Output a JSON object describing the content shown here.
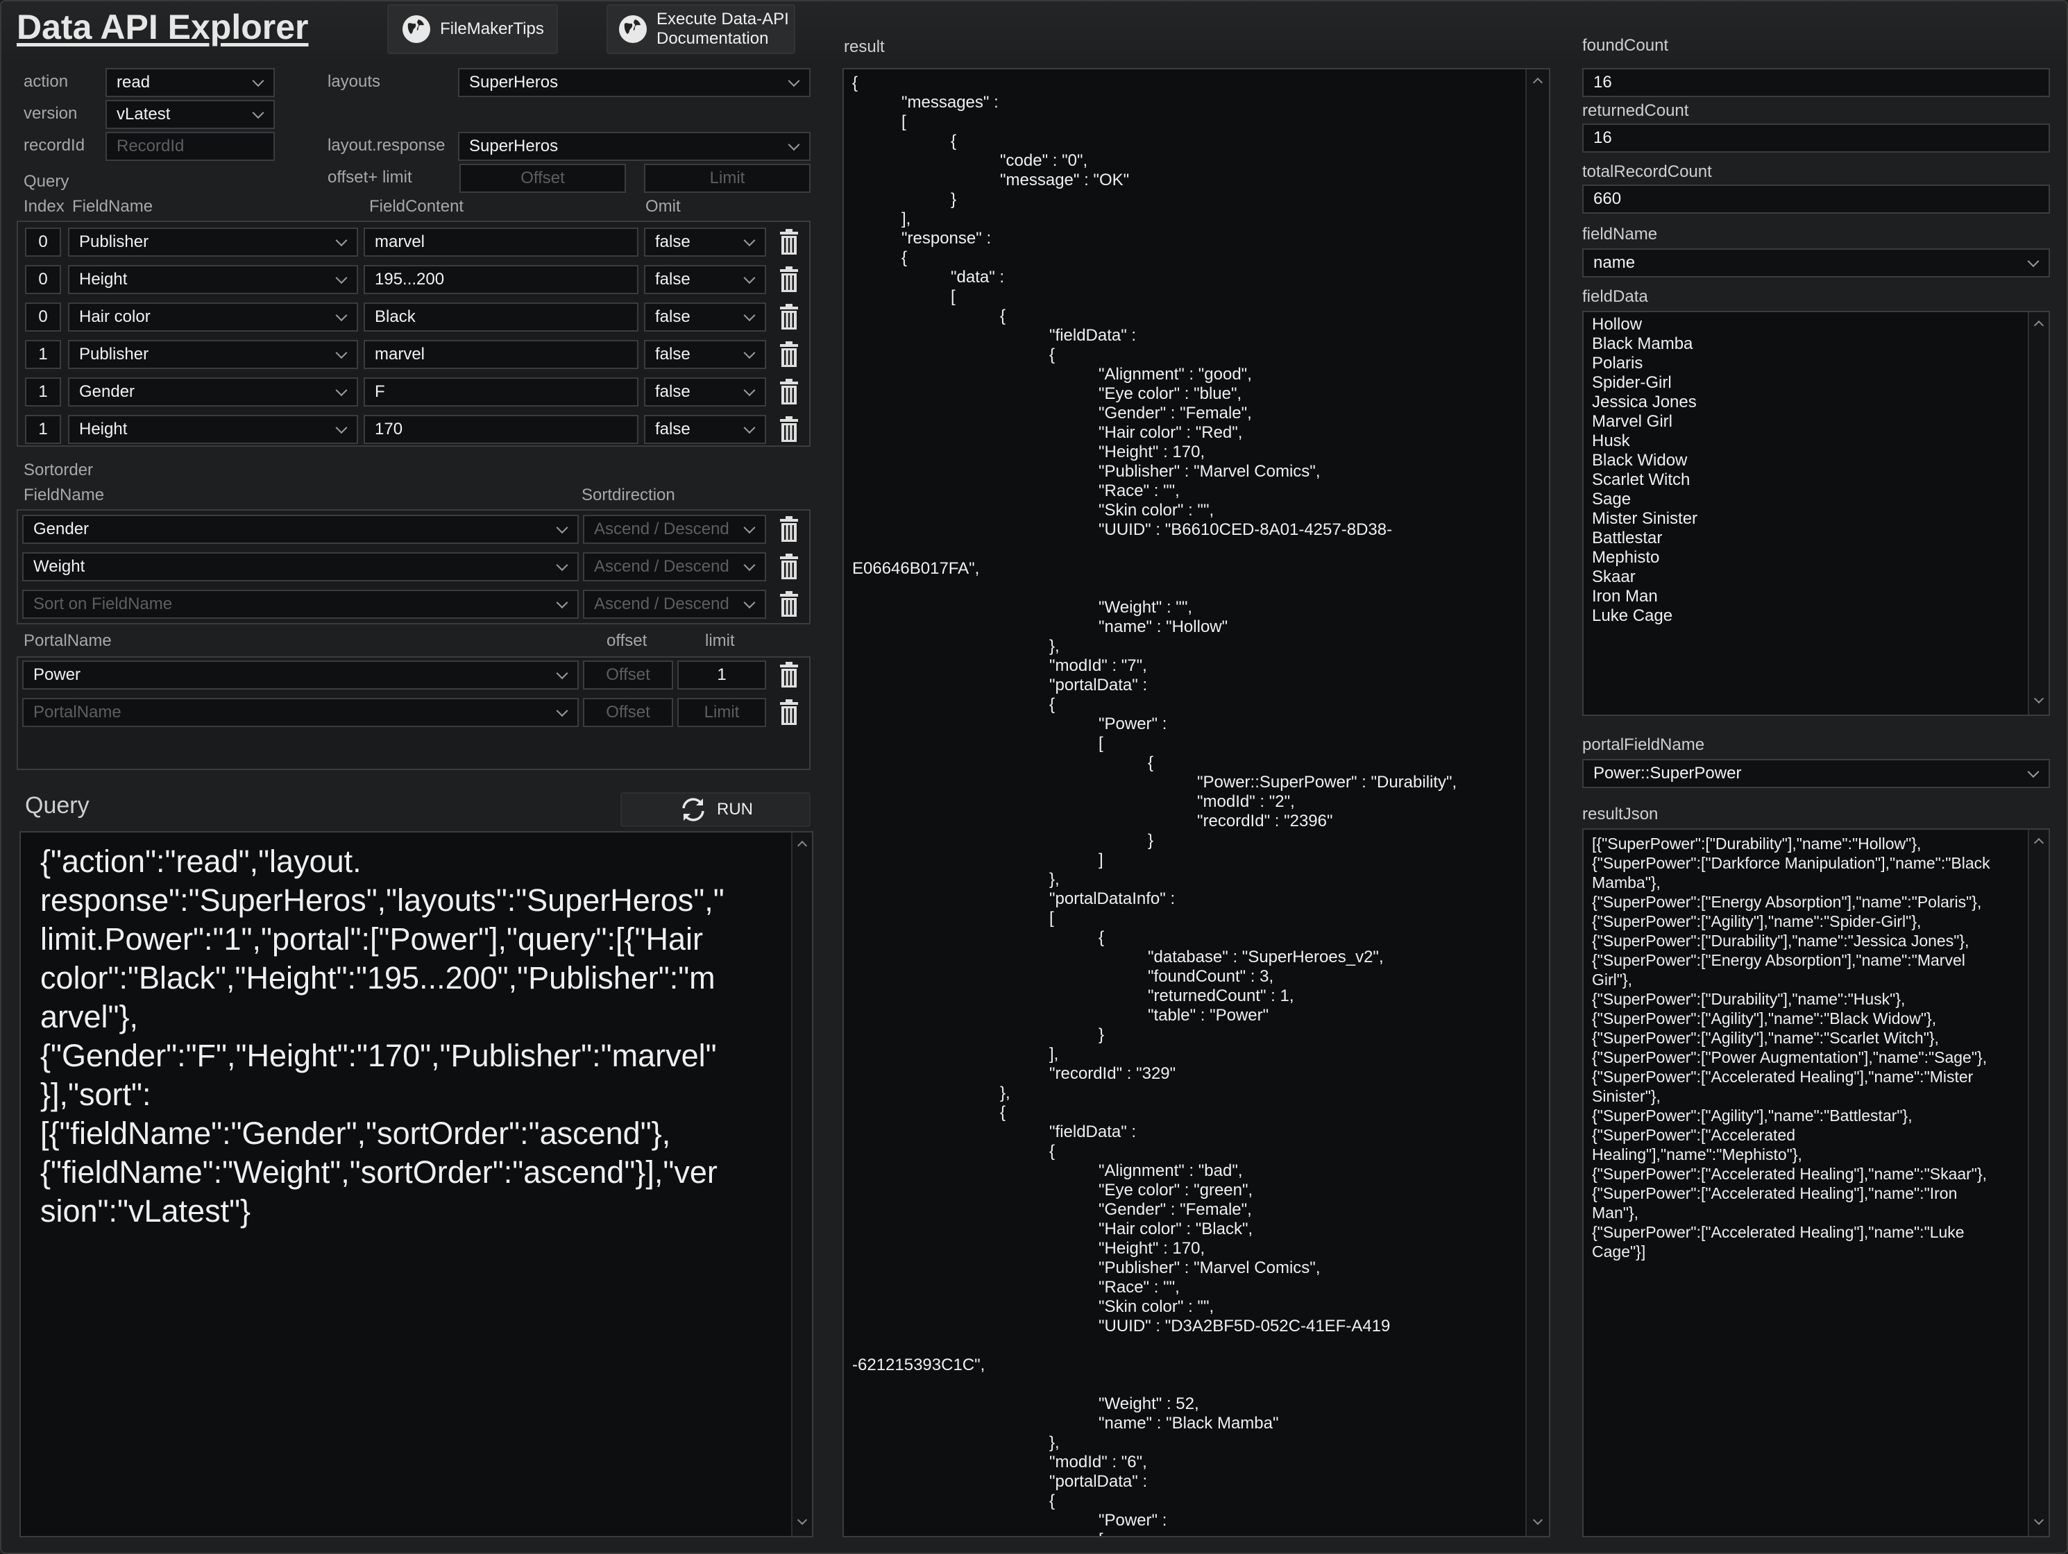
{
  "header": {
    "title": "Data API Explorer",
    "btn_filemakertips": "FileMakerTips",
    "btn_docs_line1": "Execute Data-API",
    "btn_docs_line2": "Documentation"
  },
  "form": {
    "action_label": "action",
    "action_value": "read",
    "version_label": "version",
    "version_value": "vLatest",
    "recordid_label": "recordId",
    "recordid_placeholder": "RecordId",
    "layouts_label": "layouts",
    "layouts_value": "SuperHeros",
    "layout_response_label": "layout.response",
    "layout_response_value": "SuperHeros",
    "offset_limit_label": "offset+ limit",
    "offset_placeholder": "Offset",
    "limit_placeholder": "Limit"
  },
  "query_section": {
    "title": "Query",
    "col_index": "Index",
    "col_fieldname": "FieldName",
    "col_fieldcontent": "FieldContent",
    "col_omit": "Omit",
    "rows": [
      {
        "index": "0",
        "field": "Publisher",
        "content": "marvel",
        "omit": "false"
      },
      {
        "index": "0",
        "field": "Height",
        "content": "195...200",
        "omit": "false"
      },
      {
        "index": "0",
        "field": "Hair color",
        "content": "Black",
        "omit": "false"
      },
      {
        "index": "1",
        "field": "Publisher",
        "content": "marvel",
        "omit": "false"
      },
      {
        "index": "1",
        "field": "Gender",
        "content": "F",
        "omit": "false"
      },
      {
        "index": "1",
        "field": "Height",
        "content": "170",
        "omit": "false"
      }
    ]
  },
  "sort_section": {
    "title": "Sortorder",
    "col_fieldname": "FieldName",
    "col_direction": "Sortdirection",
    "rows": [
      {
        "field": "Gender",
        "direction": "Ascend / Descend"
      },
      {
        "field": "Weight",
        "direction": "Ascend / Descend"
      },
      {
        "field": "Sort on FieldName",
        "direction": "Ascend / Descend"
      }
    ]
  },
  "portal_section": {
    "col_portalname": "PortalName",
    "col_offset": "offset",
    "col_limit": "limit",
    "rows": [
      {
        "name": "Power",
        "offset": "Offset",
        "limit": "1"
      },
      {
        "name": "PortalName",
        "offset": "Offset",
        "limit": "Limit"
      }
    ]
  },
  "query_output": {
    "title": "Query",
    "run_label": "RUN",
    "text": "{\"action\":\"read\",\"layout.\nresponse\":\"SuperHeros\",\"layouts\":\"SuperHeros\",\"\nlimit.Power\":\"1\",\"portal\":[\"Power\"],\"query\":[{\"Hair\ncolor\":\"Black\",\"Height\":\"195...200\",\"Publisher\":\"m\narvel\"},\n{\"Gender\":\"F\",\"Height\":\"170\",\"Publisher\":\"marvel\"\n}],\"sort\":\n[{\"fieldName\":\"Gender\",\"sortOrder\":\"ascend\"},\n{\"fieldName\":\"Weight\",\"sortOrder\":\"ascend\"}],\"ver\nsion\":\"vLatest\"}"
  },
  "result": {
    "label": "result",
    "text": "{\n\t\"messages\" :\n\t[\n\t\t{\n\t\t\t\"code\" : \"0\",\n\t\t\t\"message\" : \"OK\"\n\t\t}\n\t],\n\t\"response\" :\n\t{\n\t\t\"data\" :\n\t\t[\n\t\t\t{\n\t\t\t\t\"fieldData\" :\n\t\t\t\t{\n\t\t\t\t\t\"Alignment\" : \"good\",\n\t\t\t\t\t\"Eye color\" : \"blue\",\n\t\t\t\t\t\"Gender\" : \"Female\",\n\t\t\t\t\t\"Hair color\" : \"Red\",\n\t\t\t\t\t\"Height\" : 170,\n\t\t\t\t\t\"Publisher\" : \"Marvel Comics\",\n\t\t\t\t\t\"Race\" : \"\",\n\t\t\t\t\t\"Skin color\" : \"\",\n\t\t\t\t\t\"UUID\" : \"B6610CED-8A01-4257-8D38-\n\nE06646B017FA\",\n\n\t\t\t\t\t\"Weight\" : \"\",\n\t\t\t\t\t\"name\" : \"Hollow\"\n\t\t\t\t},\n\t\t\t\t\"modId\" : \"7\",\n\t\t\t\t\"portalData\" :\n\t\t\t\t{\n\t\t\t\t\t\"Power\" :\n\t\t\t\t\t[\n\t\t\t\t\t\t{\n\t\t\t\t\t\t\t\"Power::SuperPower\" : \"Durability\",\n\t\t\t\t\t\t\t\"modId\" : \"2\",\n\t\t\t\t\t\t\t\"recordId\" : \"2396\"\n\t\t\t\t\t\t}\n\t\t\t\t\t]\n\t\t\t\t},\n\t\t\t\t\"portalDataInfo\" :\n\t\t\t\t[\n\t\t\t\t\t{\n\t\t\t\t\t\t\"database\" : \"SuperHeroes_v2\",\n\t\t\t\t\t\t\"foundCount\" : 3,\n\t\t\t\t\t\t\"returnedCount\" : 1,\n\t\t\t\t\t\t\"table\" : \"Power\"\n\t\t\t\t\t}\n\t\t\t\t],\n\t\t\t\t\"recordId\" : \"329\"\n\t\t\t},\n\t\t\t{\n\t\t\t\t\"fieldData\" :\n\t\t\t\t{\n\t\t\t\t\t\"Alignment\" : \"bad\",\n\t\t\t\t\t\"Eye color\" : \"green\",\n\t\t\t\t\t\"Gender\" : \"Female\",\n\t\t\t\t\t\"Hair color\" : \"Black\",\n\t\t\t\t\t\"Height\" : 170,\n\t\t\t\t\t\"Publisher\" : \"Marvel Comics\",\n\t\t\t\t\t\"Race\" : \"\",\n\t\t\t\t\t\"Skin color\" : \"\",\n\t\t\t\t\t\"UUID\" : \"D3A2BF5D-052C-41EF-A419\n\n-621215393C1C\",\n\n\t\t\t\t\t\"Weight\" : 52,\n\t\t\t\t\t\"name\" : \"Black Mamba\"\n\t\t\t\t},\n\t\t\t\t\"modId\" : \"6\",\n\t\t\t\t\"portalData\" :\n\t\t\t\t{\n\t\t\t\t\t\"Power\" :\n\t\t\t\t\t[\n\t\t\t\t\t\t{\n\t\t\t\t\t\t\t\"Power::SuperPower\" : \"Darkforce\nManipulation\","
  },
  "right": {
    "foundcount_label": "foundCount",
    "foundcount_value": "16",
    "returnedcount_label": "returnedCount",
    "returnedcount_value": "16",
    "totalrecordcount_label": "totalRecordCount",
    "totalrecordcount_value": "660",
    "fieldname_label": "fieldName",
    "fieldname_value": "name",
    "fielddata_label": "fieldData",
    "fielddata_items": [
      "Hollow",
      "Black Mamba",
      "Polaris",
      "Spider-Girl",
      "Jessica Jones",
      "Marvel Girl",
      "Husk",
      "Black Widow",
      "Scarlet Witch",
      "Sage",
      "Mister Sinister",
      "Battlestar",
      "Mephisto",
      "Skaar",
      "Iron Man",
      "Luke Cage"
    ],
    "portalfieldname_label": "portalFieldName",
    "portalfieldname_value": "Power::SuperPower",
    "resultjson_label": "resultJson",
    "resultjson_text": "[{\"SuperPower\":[\"Durability\"],\"name\":\"Hollow\"},\n{\"SuperPower\":[\"Darkforce Manipulation\"],\"name\":\"Black\nMamba\"},\n{\"SuperPower\":[\"Energy Absorption\"],\"name\":\"Polaris\"},\n{\"SuperPower\":[\"Agility\"],\"name\":\"Spider-Girl\"},\n{\"SuperPower\":[\"Durability\"],\"name\":\"Jessica Jones\"},\n{\"SuperPower\":[\"Energy Absorption\"],\"name\":\"Marvel\nGirl\"},\n{\"SuperPower\":[\"Durability\"],\"name\":\"Husk\"},\n{\"SuperPower\":[\"Agility\"],\"name\":\"Black Widow\"},\n{\"SuperPower\":[\"Agility\"],\"name\":\"Scarlet Witch\"},\n{\"SuperPower\":[\"Power Augmentation\"],\"name\":\"Sage\"},\n{\"SuperPower\":[\"Accelerated Healing\"],\"name\":\"Mister\nSinister\"},\n{\"SuperPower\":[\"Agility\"],\"name\":\"Battlestar\"},\n{\"SuperPower\":[\"Accelerated\nHealing\"],\"name\":\"Mephisto\"},\n{\"SuperPower\":[\"Accelerated Healing\"],\"name\":\"Skaar\"},\n{\"SuperPower\":[\"Accelerated Healing\"],\"name\":\"Iron\nMan\"},\n{\"SuperPower\":[\"Accelerated Healing\"],\"name\":\"Luke\nCage\"}]"
  }
}
